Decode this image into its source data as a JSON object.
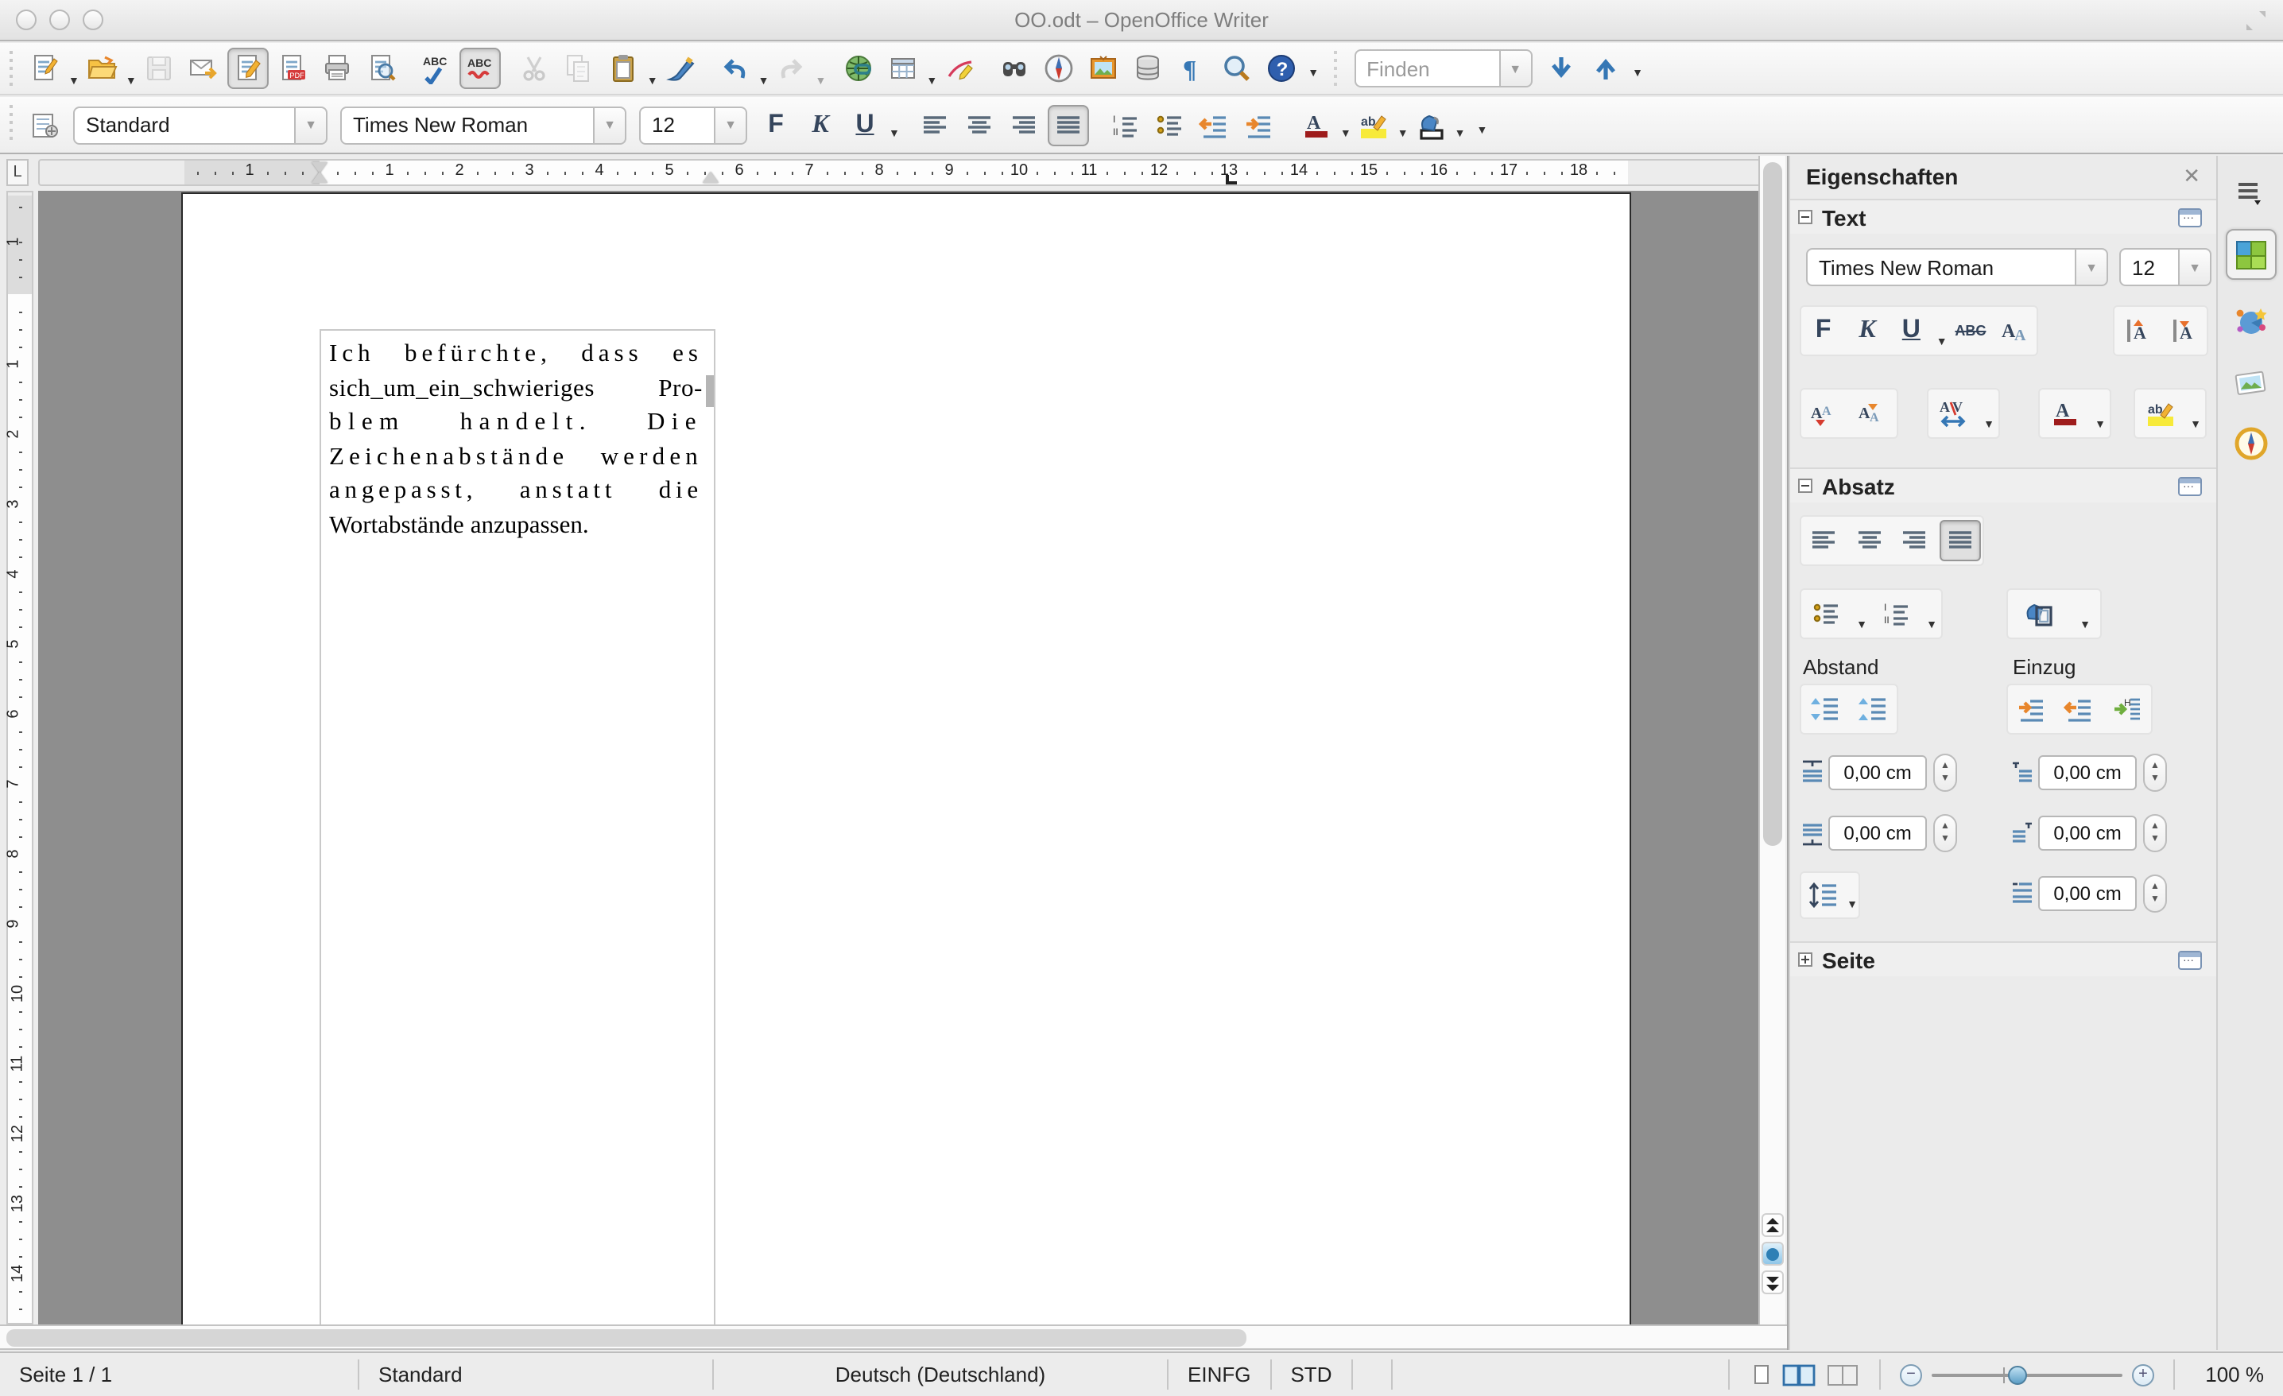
{
  "window": {
    "title": "OO.odt – OpenOffice Writer"
  },
  "toolbars": {
    "standard": [
      {
        "name": "new-document",
        "dropdown": true
      },
      {
        "name": "open",
        "dropdown": true
      },
      {
        "name": "save",
        "disabled": true
      },
      {
        "name": "email-document"
      },
      {
        "name": "edit-file",
        "pressed": true
      },
      {
        "name": "export-pdf"
      },
      {
        "name": "print"
      },
      {
        "name": "page-preview"
      },
      {
        "name": "spellcheck"
      },
      {
        "name": "auto-spellcheck",
        "pressed": true
      },
      {
        "name": "cut",
        "disabled": true
      },
      {
        "name": "copy",
        "disabled": true
      },
      {
        "name": "paste",
        "dropdown": true
      },
      {
        "name": "format-paintbrush"
      },
      {
        "name": "undo",
        "dropdown": true
      },
      {
        "name": "redo",
        "disabled": true,
        "dropdown": true
      },
      {
        "name": "hyperlink"
      },
      {
        "name": "table",
        "dropdown": true
      },
      {
        "name": "draw-functions"
      },
      {
        "name": "find-replace"
      },
      {
        "name": "navigator"
      },
      {
        "name": "gallery"
      },
      {
        "name": "data-sources"
      },
      {
        "name": "formatting-marks"
      },
      {
        "name": "zoom"
      },
      {
        "name": "help"
      }
    ],
    "find": {
      "placeholder": "Finden"
    },
    "formatting": {
      "paragraph_style": "Standard",
      "font_name": "Times New Roman",
      "font_size": "12",
      "buttons": [
        {
          "name": "bold",
          "label": "F"
        },
        {
          "name": "italic",
          "label": "K"
        },
        {
          "name": "underline",
          "label": "U",
          "dropdown": true
        },
        {
          "name": "align-left"
        },
        {
          "name": "align-center"
        },
        {
          "name": "align-right"
        },
        {
          "name": "align-justify",
          "pressed": true
        },
        {
          "name": "numbered-list"
        },
        {
          "name": "bullet-list"
        },
        {
          "name": "decrease-indent"
        },
        {
          "name": "increase-indent"
        },
        {
          "name": "font-color",
          "dropdown": true
        },
        {
          "name": "highlighting",
          "dropdown": true
        },
        {
          "name": "background-color",
          "dropdown": true
        }
      ]
    }
  },
  "ruler": {
    "h_margin_label": "1",
    "h_numbers": [
      1,
      2,
      3,
      4,
      5,
      6,
      7,
      8,
      9,
      10,
      11,
      12,
      13,
      14,
      15,
      16,
      17,
      18
    ],
    "v_margin_label": "1",
    "v_numbers": [
      1,
      2,
      3,
      4,
      5,
      6,
      7,
      8,
      9,
      10,
      11,
      12,
      13,
      14
    ],
    "indent_marker_cm": 0,
    "right_indent_marker_cm": 5.6,
    "tab_marker_cm": 13
  },
  "document": {
    "lines": [
      {
        "words": [
          "Ich",
          "befürchte,",
          "dass",
          "es"
        ],
        "letter_spacing": 3,
        "justified": true
      },
      {
        "words": [
          "sich_um_ein_schwieriges",
          "Pro-"
        ],
        "letter_spacing": 0.3,
        "justified": true
      },
      {
        "words": [
          "blem",
          "handelt.",
          "Die"
        ],
        "letter_spacing": 4.2,
        "justified": true
      },
      {
        "words": [
          "Zeichenabstände",
          "werden"
        ],
        "letter_spacing": 3.1,
        "justified": true
      },
      {
        "words": [
          "angepasst,",
          "anstatt",
          "die"
        ],
        "letter_spacing": 2.9,
        "justified": true
      },
      {
        "words": [
          "Wortabstände",
          "anzupassen."
        ],
        "letter_spacing": 0,
        "justified": false
      }
    ],
    "full_text": "Ich befürchte, dass es sich_um_ein_schwieriges Problem handelt. Die Zeichenabstände werden angepasst, anstatt die Wortabstände anzupassen."
  },
  "sidebar": {
    "title": "Eigenschaften",
    "close_icon": "✕",
    "sections": {
      "text": {
        "label": "Text",
        "font_name": "Times New Roman",
        "font_size": "12",
        "buttons_row1": [
          "bold",
          "italic",
          "underline",
          "strikethrough",
          "change-case"
        ],
        "buttons_row1_right": [
          "increase-font-size",
          "decrease-font-size"
        ],
        "buttons_row2": [
          "uppercase",
          "lowercase",
          "character-spacing",
          "font-color",
          "highlighting"
        ]
      },
      "paragraph": {
        "label": "Absatz",
        "alignment": [
          "align-left",
          "align-center",
          "align-right",
          "align-justify"
        ],
        "alignment_pressed": "align-justify",
        "lists": [
          "bullet-list",
          "numbered-list"
        ],
        "background": "paragraph-background",
        "spacing_label": "Abstand",
        "indent_label": "Einzug",
        "spacing_buttons": [
          "increase-spacing",
          "decrease-spacing"
        ],
        "indent_buttons": [
          "increase-indent",
          "decrease-indent",
          "switch-indent"
        ],
        "fields": {
          "above_paragraph": "0,00 cm",
          "below_paragraph": "0,00 cm",
          "indent_before": "0,00 cm",
          "indent_after": "0,00 cm",
          "indent_first_line": "0,00 cm"
        }
      },
      "page": {
        "label": "Seite",
        "collapsed": true
      }
    },
    "rail": [
      "sidebar-menu",
      "properties-deck",
      "styles-deck",
      "gallery-deck",
      "navigator-deck"
    ],
    "rail_active": "properties-deck"
  },
  "statusbar": {
    "page": "Seite 1 / 1",
    "style": "Standard",
    "language": "Deutsch (Deutschland)",
    "insert_mode": "EINFG",
    "selection_mode": "STD",
    "view_layouts": [
      "single-page",
      "multi-page",
      "book-view"
    ],
    "view_layout_active": "multi-page",
    "zoom_value": "100 %"
  },
  "colors": {
    "workspace": "#8e8e8e",
    "chrome": "#ececec",
    "accent_blue": "#3c76b0",
    "accent_orange": "#e8862c",
    "font_color_bar": "#9e1c1c",
    "highlight_yellow": "#f7ea3a"
  }
}
